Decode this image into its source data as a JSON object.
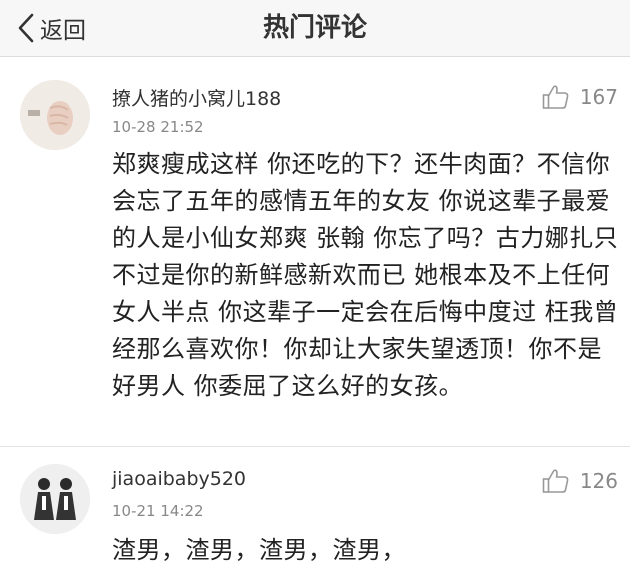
{
  "navbar": {
    "back_label": "返回",
    "title": "热门评论",
    "back_icon": "chevron-left-icon"
  },
  "comments": [
    {
      "username": "撩人猪的小窝儿188",
      "timestamp": "10-28 21:52",
      "likes": "167",
      "like_icon": "thumbs-up-icon",
      "text": "郑爽瘦成这样 你还吃的下？还牛肉面？不信你会忘了五年的感情五年的女友 你说这辈子最爱的人是小仙女郑爽 张翰 你忘了吗？古力娜扎只不过是你的新鲜感新欢而已 她根本及不上任何女人半点 你这辈子一定会在后悔中度过 枉我曾经那么喜欢你！你却让大家失望透顶！你不是好男人 你委屈了这么好的女孩。"
    },
    {
      "username": "jiaoaibaby520",
      "timestamp": "10-21 14:22",
      "likes": "126",
      "like_icon": "thumbs-up-icon",
      "text": "渣男，渣男，渣男，渣男，"
    }
  ],
  "colors": {
    "navbar_bg": "#f7f7f7",
    "text": "#222222",
    "muted": "#888888",
    "divider": "#e3e3e3"
  }
}
